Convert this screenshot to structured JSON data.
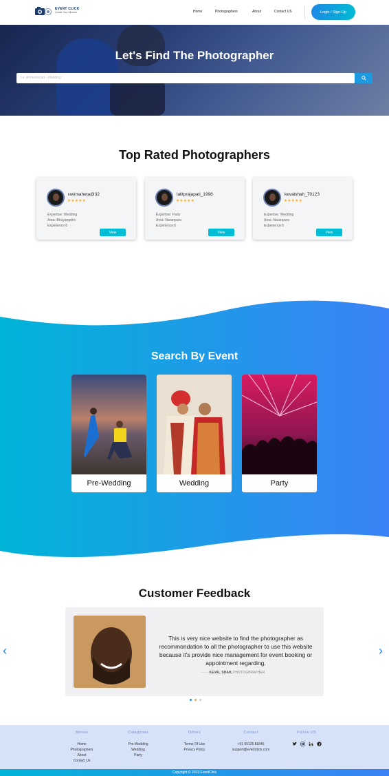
{
  "nav": {
    "logo_main": "EVENT CLICK",
    "logo_sub": "Create Your Moment",
    "links": [
      "Home",
      "Photographers",
      "About",
      "Contact US"
    ],
    "login_label": "Login / Sign-Up"
  },
  "hero": {
    "title": "Let's Find The Photographer",
    "search_placeholder": "I.e. Ahmedabad , Wedding"
  },
  "top_rated": {
    "title": "Top Rated Photographers",
    "cards": [
      {
        "name": "ravimaheta@32",
        "stars": "★★★★★",
        "expertise": "Expertise: Wedding",
        "area": "Area: Bhuyangdev",
        "experience": "Experience:6",
        "view": "View"
      },
      {
        "name": "lalitprajapati_1998",
        "stars": "★★★★★",
        "expertise": "Expertise: Party",
        "area": "Area: Naranpura",
        "experience": "Experience:6",
        "view": "View"
      },
      {
        "name": "kevalshah_70123",
        "stars": "★★★★★",
        "expertise": "Expertise: Wedding",
        "area": "Area: Naranpura",
        "experience": "Experience:6",
        "view": "View"
      }
    ]
  },
  "events": {
    "title": "Search By Event",
    "items": [
      "Pre-Wedding",
      "Wedding",
      "Party"
    ]
  },
  "feedback": {
    "title": "Customer Feedback",
    "text": "This is very nice website to find the photographer as recommondation to all the photographer to use this website because it's provide nice management for event booking or appointment regarding.",
    "author_name": "KEVAL SHAH,",
    "author_role": " PHOTOGHRAPHER."
  },
  "footer": {
    "menus": {
      "title": "Menus",
      "items": [
        "Home",
        "Photographers",
        "About",
        "Contact Us"
      ]
    },
    "categories": {
      "title": "Categories",
      "items": [
        "Pre-Wedding",
        "Wedding",
        "Party"
      ]
    },
    "others": {
      "title": "Others",
      "items": [
        "Terms Of Use",
        "Privacy Policy"
      ]
    },
    "contact": {
      "title": "Contact",
      "items": [
        "+91 65125 81845",
        "support@eventclick.com"
      ]
    },
    "follow": {
      "title": "Follow US"
    },
    "copyright": "Copyright © 2023 EventClick"
  },
  "colors": {
    "accent": "#00bcd4",
    "primary": "#1e88e5",
    "star": "#f5a623",
    "footer_bg": "#d6e2f7"
  }
}
